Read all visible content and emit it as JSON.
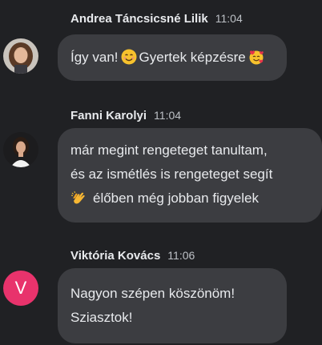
{
  "messages": [
    {
      "sender": "Andrea Táncsicsné Lilik",
      "time": "11:04",
      "text_part1": "Így van!",
      "emoji1": "smiling-face-emoji",
      "text_part2": "Gyertek képzésre",
      "emoji2": "smiling-face-with-hearts-emoji"
    },
    {
      "sender": "Fanni Karolyi",
      "time": "11:04",
      "line1": "már megint rengeteget tanultam,",
      "line2": "és az ismétlés is rengeteget segít",
      "emoji": "clapping-hands-emoji",
      "line3": "élőben még jobban figyelek"
    },
    {
      "sender": "Viktória Kovács",
      "time": "11:06",
      "avatar_letter": "V",
      "line1": "Nagyon szépen köszönöm!",
      "line2": "Sziasztok!"
    }
  ],
  "colors": {
    "background": "#202124",
    "bubble": "#3c3d41",
    "avatar_v": "#e8336c"
  }
}
